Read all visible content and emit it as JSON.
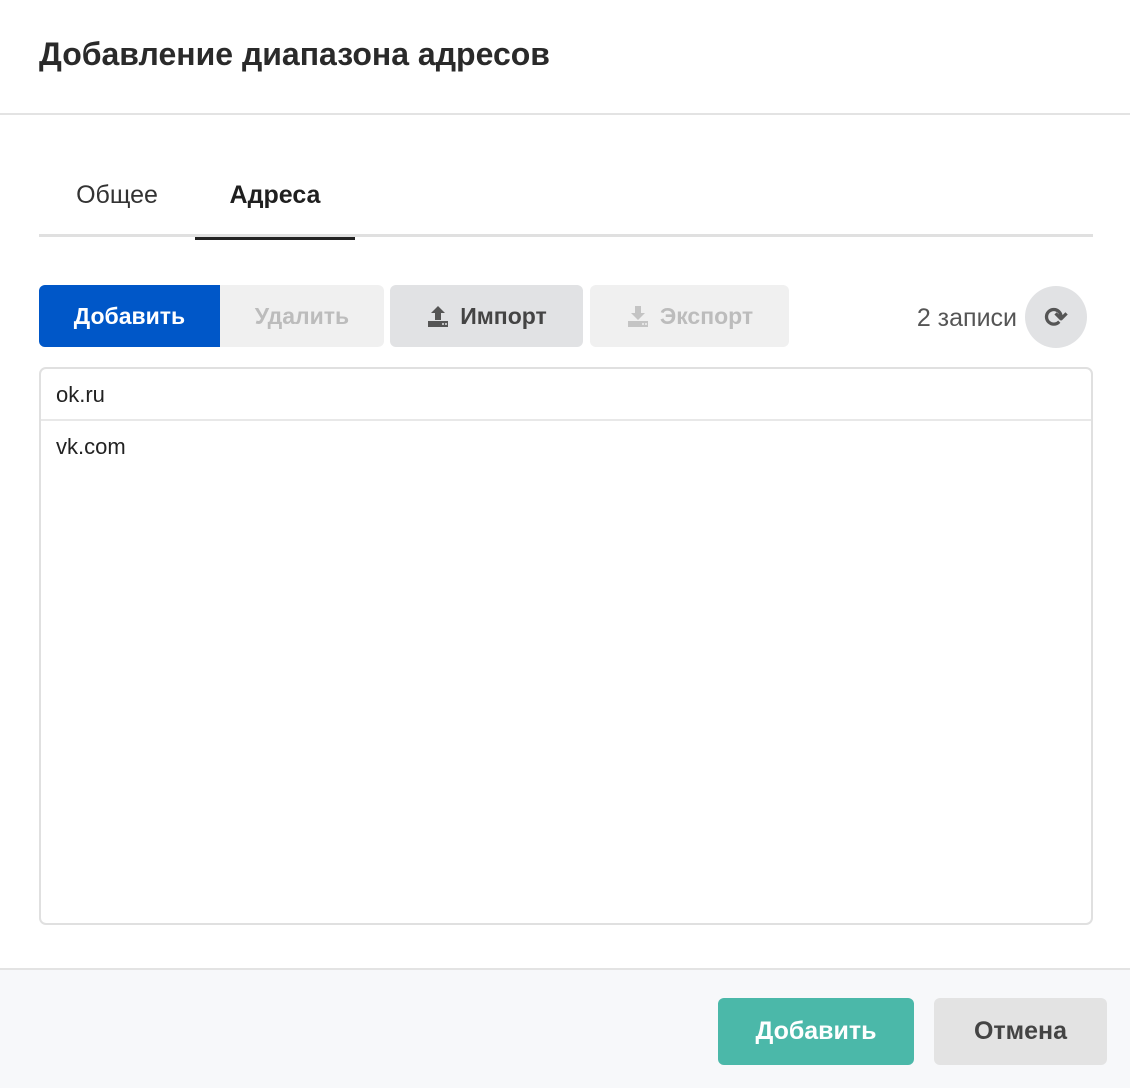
{
  "dialog": {
    "title": "Добавление диапазона адресов"
  },
  "tabs": [
    {
      "label": "Общее"
    },
    {
      "label": "Адреса"
    }
  ],
  "toolbar": {
    "add": "Добавить",
    "delete": "Удалить",
    "import": "Импорт",
    "export": "Экспорт",
    "count": "2 записи"
  },
  "list": {
    "items": [
      "ok.ru",
      "vk.com"
    ]
  },
  "footer": {
    "ok": "Добавить",
    "cancel": "Отмена"
  },
  "colors": {
    "primary": "#0057c8",
    "confirm": "#4bb8a9"
  }
}
